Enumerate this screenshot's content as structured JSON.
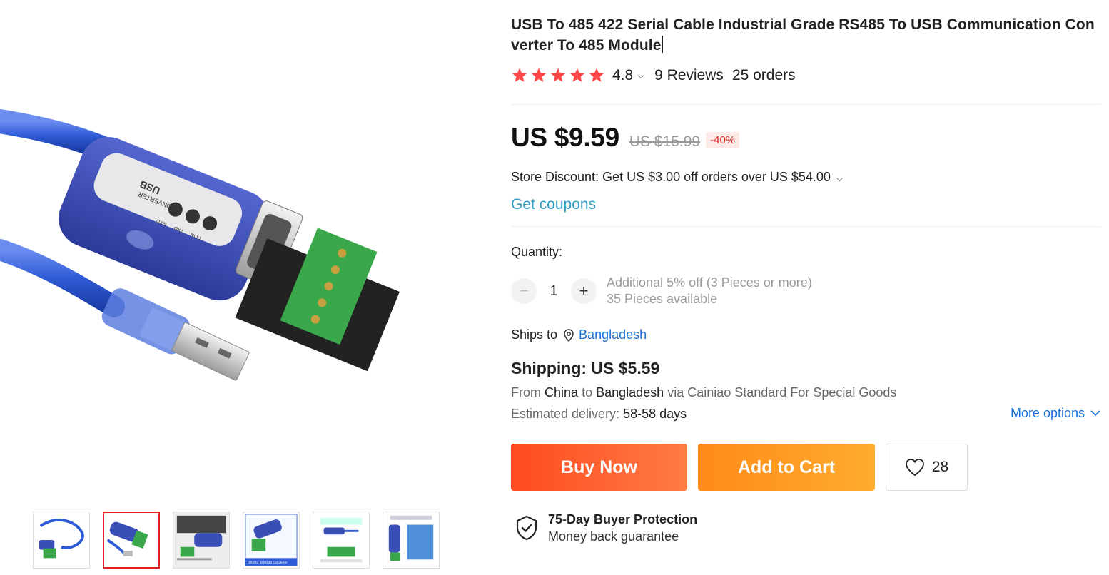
{
  "product": {
    "title": "USB To 485 422 Serial Cable Industrial Grade RS485 To USB Communication Converter To 485 Module",
    "rating": "4.8",
    "reviews": "9 Reviews",
    "orders": "25 orders",
    "star_count": 5,
    "price": "US $9.59",
    "original_price": "US $15.99",
    "discount": "-40%",
    "store_discount": "Store Discount: Get US $3.00 off orders over US $54.00",
    "coupons_link": "Get coupons"
  },
  "device_labels": {
    "brand": "USB",
    "model": "CONVERTER",
    "led_rxd": "RXD",
    "led_txd": "TXD",
    "led_pon": "PON"
  },
  "quantity": {
    "label": "Quantity:",
    "value": "1",
    "decrement": "−",
    "increment": "+",
    "offer": "Additional 5% off (3 Pieces or more)",
    "available": "35 Pieces available"
  },
  "shipping": {
    "ships_to_label": "Ships to",
    "country": "Bangladesh",
    "title": "Shipping: US $5.59",
    "from_prefix": "From",
    "from_country": "China",
    "to_word": "to",
    "to_country": "Bangladesh",
    "via_text": "via Cainiao Standard For Special Goods",
    "estimated_label": "Estimated delivery:",
    "estimated_value": "58-58 days",
    "more_options": "More options"
  },
  "actions": {
    "buy_now": "Buy Now",
    "add_to_cart": "Add to Cart",
    "wishlist_count": "28"
  },
  "protection": {
    "title": "75-Day Buyer Protection",
    "subtitle": "Money back guarantee"
  },
  "gallery": {
    "thumbnail_count": 6,
    "active_index": 1,
    "thumb_caption_4": "USB to 485/422 converter"
  },
  "colors": {
    "star": "#ff4747",
    "link": "#1a73d9",
    "coupon": "#2e9cc3",
    "buy_now": "#ff4a1f",
    "add_to_cart": "#ff9a1f",
    "discount": "#e02020",
    "device_blue": "#3a4fb5",
    "terminal_green": "#3aa84a"
  }
}
